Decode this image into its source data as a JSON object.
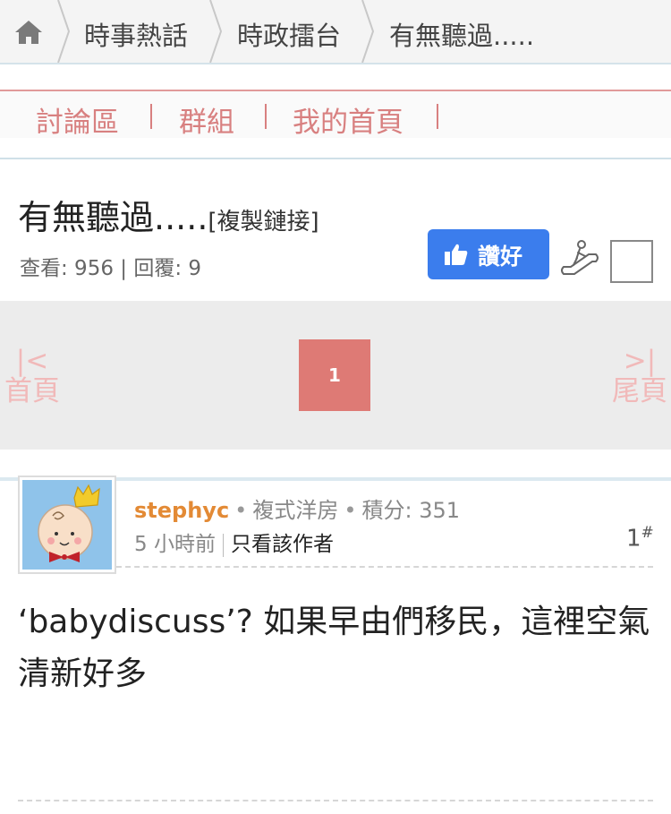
{
  "breadcrumb": {
    "items": [
      "時事熱話",
      "時政擂台",
      "有無聽過....."
    ]
  },
  "nav": {
    "items": [
      "討論區",
      "群組",
      "我的首頁"
    ]
  },
  "thread": {
    "title": "有無聽過.....",
    "copy_link": "[複製鏈接]",
    "stats": "查看: 956 | 回覆: 9",
    "like_label": "讚好"
  },
  "pager": {
    "first_arrow": "|<",
    "first_label": "首頁",
    "current_page": "1",
    "last_arrow": ">|",
    "last_label": "尾頁"
  },
  "post": {
    "username": "stephyc",
    "rank": "複式洋房",
    "points": "積分: 351",
    "time": "5 小時前",
    "only_author": "只看該作者",
    "floor": "1",
    "floor_mark": "#",
    "body": "‘babydiscuss’? 如果早由們移民，這裡空氣清新好多"
  },
  "colors": {
    "accent_nav": "#d88080",
    "like_button": "#3b7ded",
    "current_page": "#de7a75",
    "username": "#e38a35"
  },
  "icons": [
    "home-icon",
    "thumbs-up-icon",
    "escalator-icon"
  ]
}
